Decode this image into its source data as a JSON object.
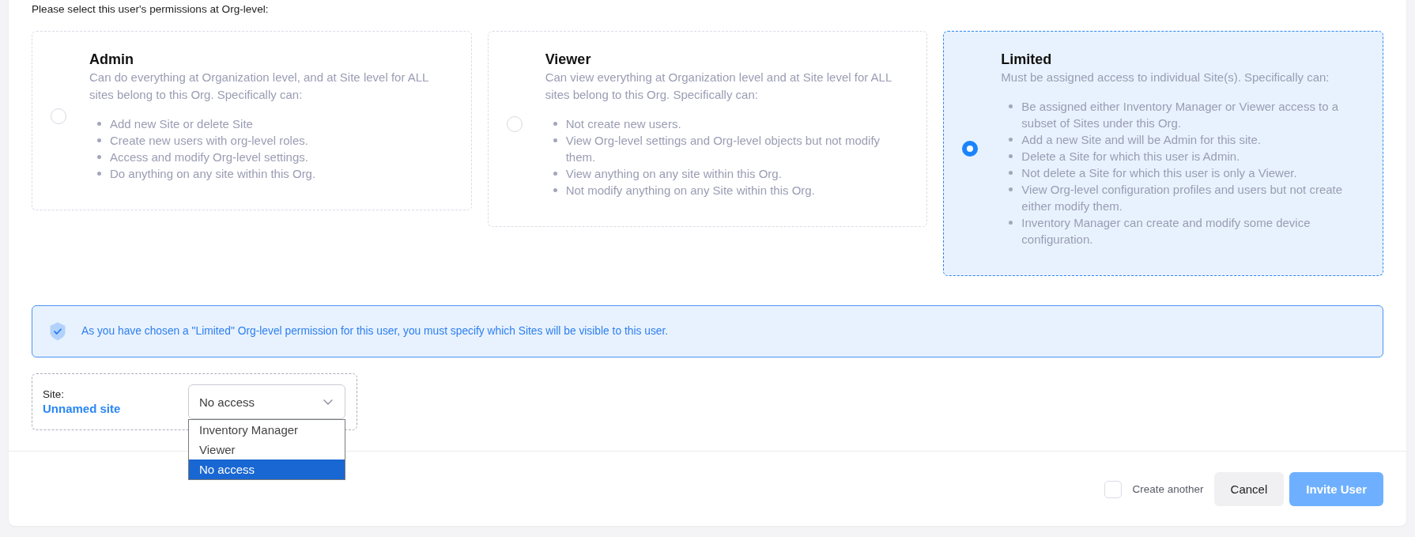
{
  "instruction": "Please select this user's permissions at Org-level:",
  "permission_options": [
    {
      "title": "Admin",
      "description": "Can do everything at Organization level, and at Site level for ALL sites belong to this Org. Specifically can:",
      "bullets": [
        "Add new Site or delete Site",
        "Create new users with org-level roles.",
        "Access and modify Org-level settings.",
        "Do anything on any site within this Org."
      ],
      "selected": false
    },
    {
      "title": "Viewer",
      "description": "Can view everything at Organization level and at Site level for ALL sites belong to this Org. Specifically can:",
      "bullets": [
        "Not create new users.",
        "View Org-level settings and Org-level objects but not modify them.",
        "View anything on any site within this Org.",
        "Not modify anything on any Site within this Org."
      ],
      "selected": false
    },
    {
      "title": "Limited",
      "description": "Must be assigned access to individual Site(s). Specifically can:",
      "bullets": [
        "Be assigned either Inventory Manager or Viewer access to a subset of Sites under this Org.",
        "Add a new Site and will be Admin for this site.",
        "Delete a Site for which this user is Admin.",
        "Not delete a Site for which this user is only a Viewer.",
        "View Org-level configuration profiles and users but not create either modify them.",
        "Inventory Manager can create and modify some device configuration."
      ],
      "selected": true
    }
  ],
  "notice": {
    "text": "As you have chosen a \"Limited\" Org-level permission for this user, you must specify which Sites will be visible to this user."
  },
  "site_access": {
    "label": "Site:",
    "site_name": "Unnamed site",
    "select": {
      "value": "No access",
      "expanded": true,
      "options": [
        {
          "label": "Inventory Manager",
          "selected": false
        },
        {
          "label": "Viewer",
          "selected": false
        },
        {
          "label": "No access",
          "selected": true
        }
      ]
    }
  },
  "footer": {
    "create_another": {
      "label": "Create another",
      "checked": false
    },
    "buttons": [
      {
        "label": "Cancel",
        "kind": "secondary"
      },
      {
        "label": "Invite User",
        "kind": "primary"
      }
    ]
  }
}
